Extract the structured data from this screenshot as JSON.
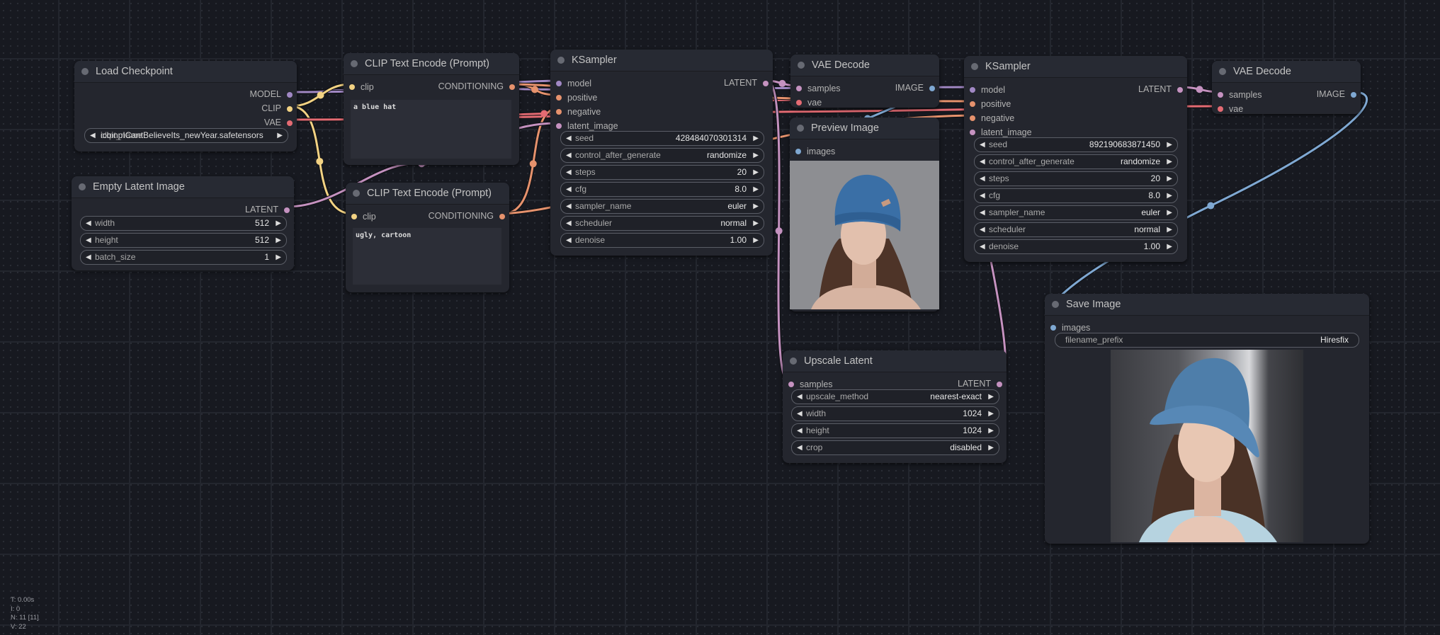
{
  "colors": {
    "model": "#a188c4",
    "clip": "#f2d283",
    "vae": "#e46b73",
    "conditioning": "#e6926d",
    "latent": "#c592c0",
    "image": "#7fa8d2"
  },
  "stats": {
    "t": "T: 0.00s",
    "i": "I: 0",
    "n": "N: 11 [11]",
    "v": "V: 22"
  },
  "nodes": {
    "load_checkpoint": {
      "title": "Load Checkpoint",
      "outputs": [
        "MODEL",
        "CLIP",
        "VAE"
      ],
      "ckpt_name": "icbinpICantBelieveIts_newYear.safetensors",
      "ckpt_name_overlap": "ckpt_name"
    },
    "empty_latent": {
      "title": "Empty Latent Image",
      "output": "LATENT",
      "widgets": [
        {
          "name": "width",
          "value": "512"
        },
        {
          "name": "height",
          "value": "512"
        },
        {
          "name": "batch_size",
          "value": "1"
        }
      ]
    },
    "clip_pos": {
      "title": "CLIP Text Encode (Prompt)",
      "input": "clip",
      "output": "CONDITIONING",
      "text": "a blue hat"
    },
    "clip_neg": {
      "title": "CLIP Text Encode (Prompt)",
      "input": "clip",
      "output": "CONDITIONING",
      "text": "ugly, cartoon"
    },
    "ksampler1": {
      "title": "KSampler",
      "inputs": [
        "model",
        "positive",
        "negative",
        "latent_image"
      ],
      "output": "LATENT",
      "widgets": [
        {
          "name": "seed",
          "value": "428484070301314"
        },
        {
          "name": "control_after_generate",
          "value": "randomize"
        },
        {
          "name": "steps",
          "value": "20"
        },
        {
          "name": "cfg",
          "value": "8.0"
        },
        {
          "name": "sampler_name",
          "value": "euler"
        },
        {
          "name": "scheduler",
          "value": "normal"
        },
        {
          "name": "denoise",
          "value": "1.00"
        }
      ]
    },
    "vae_decode1": {
      "title": "VAE Decode",
      "inputs": [
        "samples",
        "vae"
      ],
      "output": "IMAGE"
    },
    "preview": {
      "title": "Preview Image",
      "input": "images",
      "image_desc": "woman wearing knitted blue beanie"
    },
    "ksampler2": {
      "title": "KSampler",
      "inputs": [
        "model",
        "positive",
        "negative",
        "latent_image"
      ],
      "output": "LATENT",
      "widgets": [
        {
          "name": "seed",
          "value": "892190683871450"
        },
        {
          "name": "control_after_generate",
          "value": "randomize"
        },
        {
          "name": "steps",
          "value": "20"
        },
        {
          "name": "cfg",
          "value": "8.0"
        },
        {
          "name": "sampler_name",
          "value": "euler"
        },
        {
          "name": "scheduler",
          "value": "normal"
        },
        {
          "name": "denoise",
          "value": "1.00"
        }
      ]
    },
    "vae_decode2": {
      "title": "VAE Decode",
      "inputs": [
        "samples",
        "vae"
      ],
      "output": "IMAGE"
    },
    "upscale": {
      "title": "Upscale Latent",
      "input": "samples",
      "output": "LATENT",
      "widgets": [
        {
          "name": "upscale_method",
          "value": "nearest-exact"
        },
        {
          "name": "width",
          "value": "1024"
        },
        {
          "name": "height",
          "value": "1024"
        },
        {
          "name": "crop",
          "value": "disabled"
        }
      ]
    },
    "save": {
      "title": "Save Image",
      "input": "images",
      "filename_prefix_label": "filename_prefix",
      "filename_prefix": "Hiresfix",
      "image_desc": "woman wearing blue bucket hat"
    }
  }
}
